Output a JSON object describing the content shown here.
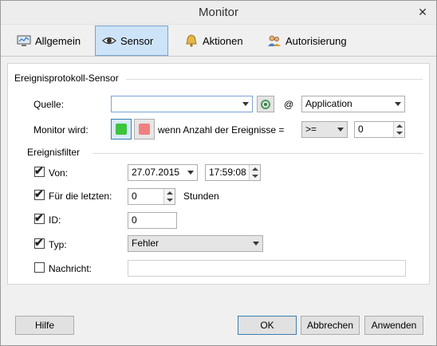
{
  "window": {
    "title": "Monitor"
  },
  "tabs": [
    {
      "label": "Allgemein",
      "icon": "monitor-icon"
    },
    {
      "label": "Sensor",
      "icon": "eye-icon"
    },
    {
      "label": "Aktionen",
      "icon": "bell-icon"
    },
    {
      "label": "Autorisierung",
      "icon": "users-icon"
    }
  ],
  "sensor": {
    "group_title": "Ereignisprotokoll-Sensor",
    "source_label": "Quelle:",
    "source_value": "",
    "at_symbol": "@",
    "log_value": "Application",
    "monitor_label": "Monitor wird:",
    "green_color": "#3dc53d",
    "red_color": "#f08080",
    "count_label": "wenn Anzahl der Ereignisse =",
    "operator_value": ">=",
    "count_value": "0"
  },
  "filter": {
    "group_title": "Ereignisfilter",
    "from": {
      "label": "Von:",
      "checked": true,
      "date": "27.07.2015",
      "time": "17:59:08"
    },
    "last": {
      "label": "Für die letzten:",
      "checked": true,
      "value": "0",
      "unit": "Stunden"
    },
    "id": {
      "label": "ID:",
      "checked": true,
      "value": "0"
    },
    "type": {
      "label": "Typ:",
      "checked": true,
      "value": "Fehler"
    },
    "message": {
      "label": "Nachricht:",
      "checked": false,
      "value": ""
    }
  },
  "footer": {
    "help": "Hilfe",
    "ok": "OK",
    "cancel": "Abbrechen",
    "apply": "Anwenden"
  }
}
